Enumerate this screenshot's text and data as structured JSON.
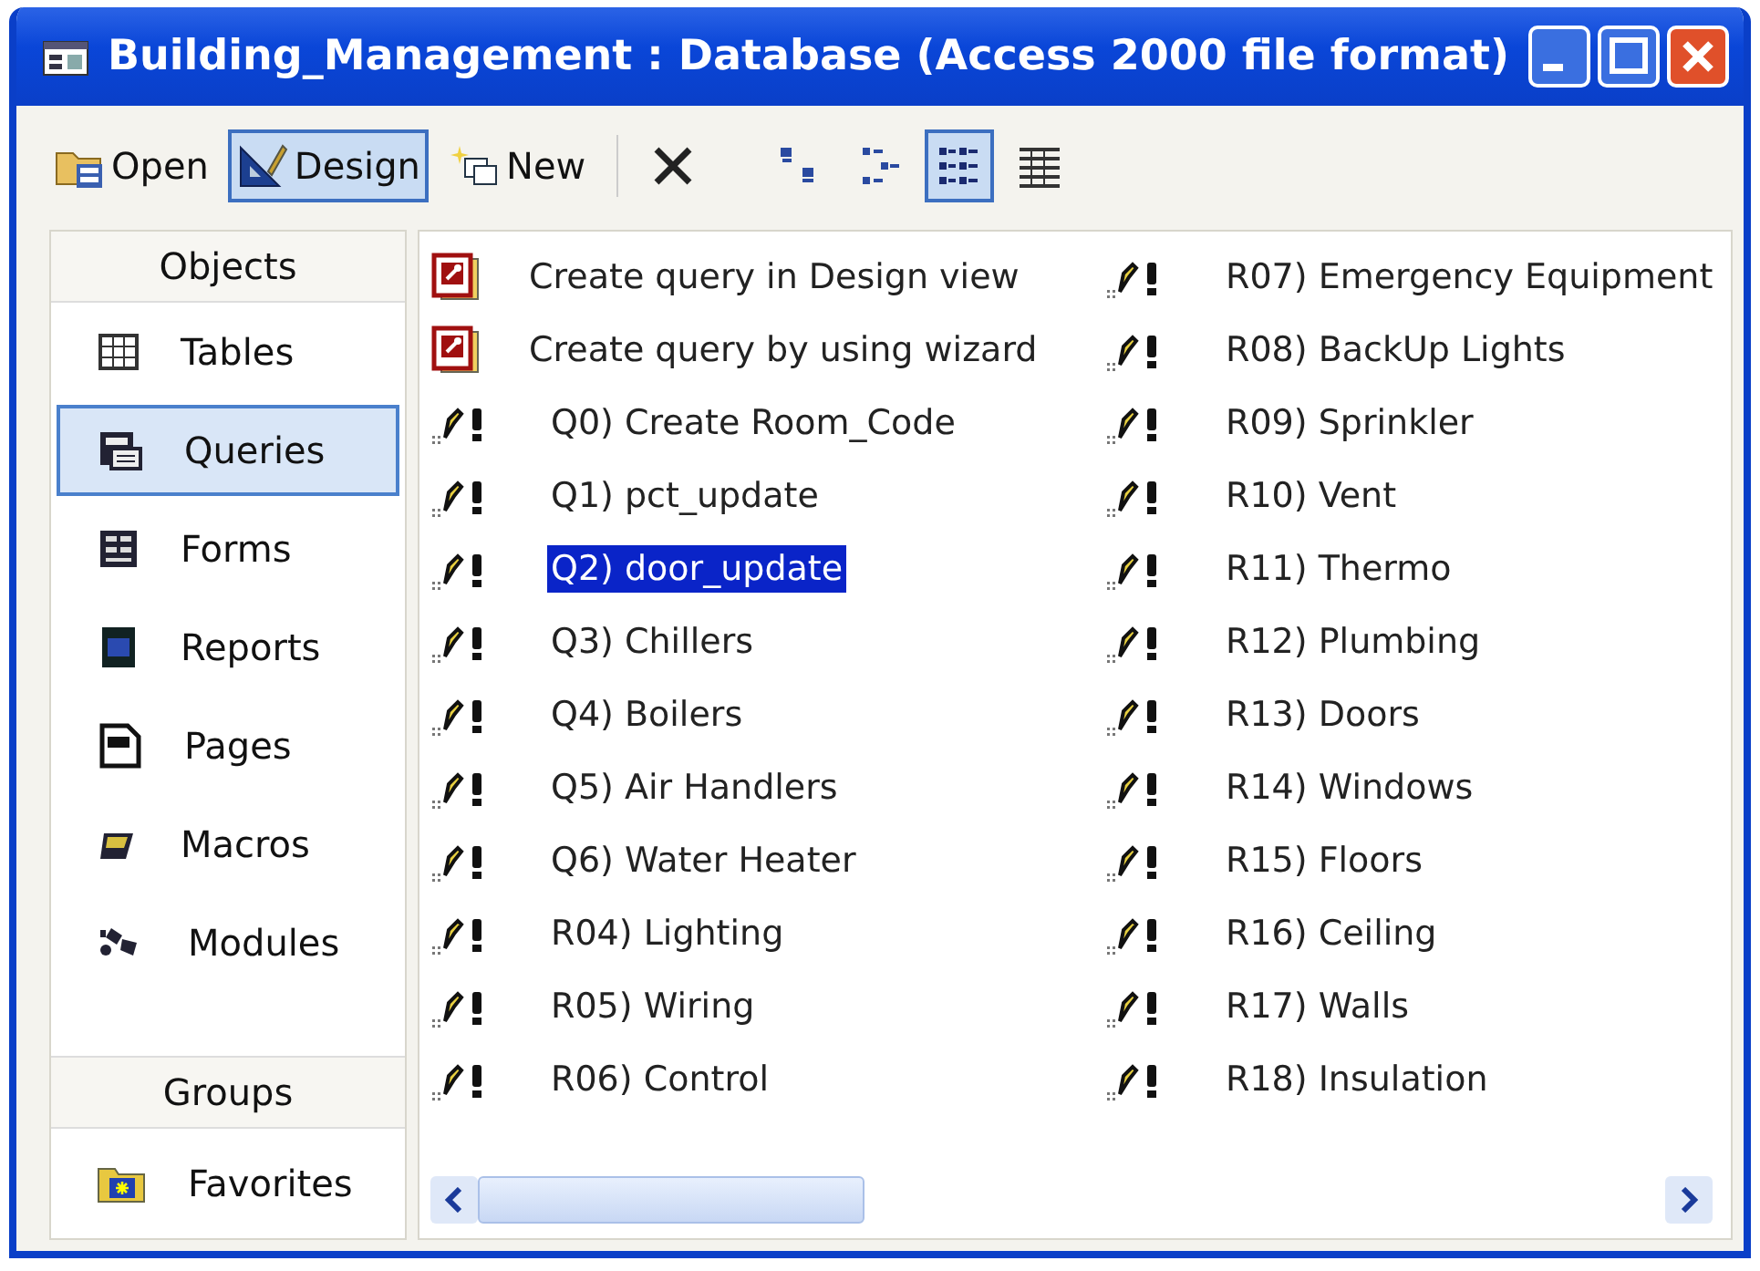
{
  "window": {
    "title": "Building_Management : Database (Access 2000 file format)",
    "controls": [
      {
        "kind": "minimize"
      },
      {
        "kind": "maximize"
      },
      {
        "kind": "close"
      }
    ]
  },
  "toolbar": {
    "buttons": [
      {
        "kind": "open",
        "label": "Open",
        "pressed": false
      },
      {
        "kind": "design",
        "label": "Design",
        "pressed": true
      },
      {
        "kind": "new",
        "label": "New",
        "pressed": false
      },
      {
        "kind": "delete",
        "pressed": false
      }
    ],
    "views": [
      {
        "kind": "large-icons",
        "selected": false
      },
      {
        "kind": "small-icons",
        "selected": false
      },
      {
        "kind": "list",
        "selected": true
      },
      {
        "kind": "details",
        "selected": false
      }
    ]
  },
  "sidebar": {
    "objects_header": "Objects",
    "items": [
      {
        "kind": "tables",
        "label": "Tables",
        "selected": false
      },
      {
        "kind": "queries",
        "label": "Queries",
        "selected": true
      },
      {
        "kind": "forms",
        "label": "Forms",
        "selected": false
      },
      {
        "kind": "reports",
        "label": "Reports",
        "selected": false
      },
      {
        "kind": "pages",
        "label": "Pages",
        "selected": false
      },
      {
        "kind": "macros",
        "label": "Macros",
        "selected": false
      },
      {
        "kind": "modules",
        "label": "Modules",
        "selected": false
      }
    ],
    "groups_header": "Groups",
    "groups": [
      {
        "label": "Favorites",
        "selected": false
      }
    ]
  },
  "objects": [
    {
      "kind": "wizard",
      "label": "Create query in Design view",
      "selected": false
    },
    {
      "kind": "wizard",
      "label": "Create query by using wizard",
      "selected": false
    },
    {
      "kind": "action-query",
      "label": "Q0) Create Room_Code",
      "selected": false
    },
    {
      "kind": "action-query",
      "label": "Q1) pct_update",
      "selected": false
    },
    {
      "kind": "action-query",
      "label": "Q2) door_update",
      "selected": true
    },
    {
      "kind": "action-query",
      "label": "Q3) Chillers",
      "selected": false
    },
    {
      "kind": "action-query",
      "label": "Q4) Boilers",
      "selected": false
    },
    {
      "kind": "action-query",
      "label": "Q5) Air Handlers",
      "selected": false
    },
    {
      "kind": "action-query",
      "label": "Q6) Water Heater",
      "selected": false
    },
    {
      "kind": "action-query",
      "label": "R04) Lighting",
      "selected": false
    },
    {
      "kind": "action-query",
      "label": "R05) Wiring",
      "selected": false
    },
    {
      "kind": "action-query",
      "label": "R06) Control",
      "selected": false
    },
    {
      "kind": "action-query",
      "label": "R07) Emergency Equipment",
      "selected": false
    },
    {
      "kind": "action-query",
      "label": "R08) BackUp Lights",
      "selected": false
    },
    {
      "kind": "action-query",
      "label": "R09) Sprinkler",
      "selected": false
    },
    {
      "kind": "action-query",
      "label": "R10) Vent",
      "selected": false
    },
    {
      "kind": "action-query",
      "label": "R11) Thermo",
      "selected": false
    },
    {
      "kind": "action-query",
      "label": "R12) Plumbing",
      "selected": false
    },
    {
      "kind": "action-query",
      "label": "R13) Doors",
      "selected": false
    },
    {
      "kind": "action-query",
      "label": "R14) Windows",
      "selected": false
    },
    {
      "kind": "action-query",
      "label": "R15) Floors",
      "selected": false
    },
    {
      "kind": "action-query",
      "label": "R16) Ceiling",
      "selected": false
    },
    {
      "kind": "action-query",
      "label": "R17) Walls",
      "selected": false
    },
    {
      "kind": "action-query",
      "label": "R18) Insulation",
      "selected": false
    }
  ]
}
